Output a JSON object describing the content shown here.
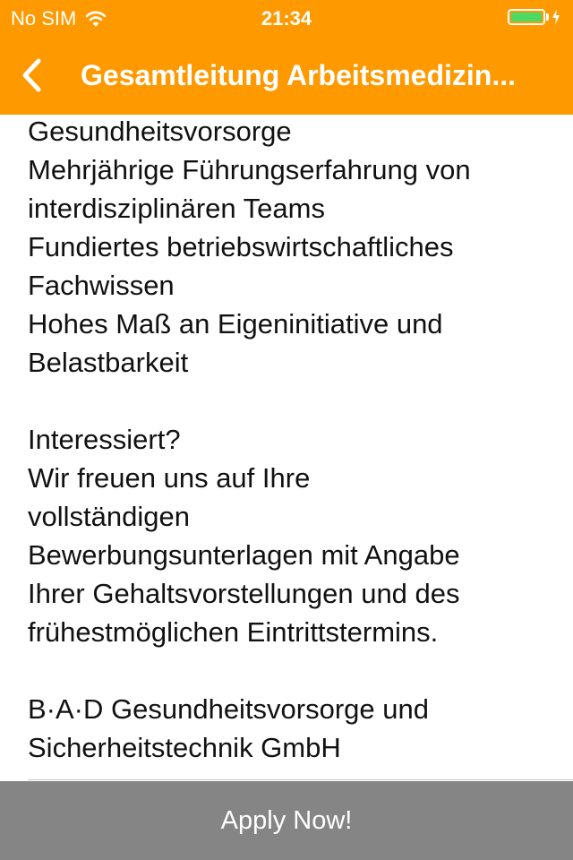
{
  "status_bar": {
    "carrier": "No SIM",
    "time": "21:34",
    "wifi_icon": "wifi-icon",
    "battery_icon": "battery-icon",
    "battery_level": 1.0,
    "charging_icon": "charging-bolt-icon"
  },
  "nav": {
    "back_icon": "chevron-left-icon",
    "title": "Gesamtleitung Arbeitsmedizin..."
  },
  "colors": {
    "nav_background": "#ff9900",
    "battery_fill": "#4cd964",
    "apply_button_background": "#858585"
  },
  "content": {
    "paragraphs": [
      [
        "Gesundheitsvorsorge",
        "Mehrjährige Führungserfahrung von",
        "interdisziplinären Teams",
        "Fundiertes betriebswirtschaftliches",
        "Fachwissen",
        "Hohes Maß an Eigeninitiative und",
        "Belastbarkeit"
      ],
      [
        "Interessiert?",
        "Wir freuen uns auf Ihre",
        "vollständigen",
        "Bewerbungsunterlagen mit Angabe",
        "Ihrer Gehaltsvorstellungen und des",
        "frühestmöglichen Eintrittstermins."
      ],
      [
        "B·A·D Gesundheitsvorsorge und",
        "Sicherheitstechnik GmbH"
      ]
    ]
  },
  "apply_button": {
    "label": "Apply Now!"
  }
}
